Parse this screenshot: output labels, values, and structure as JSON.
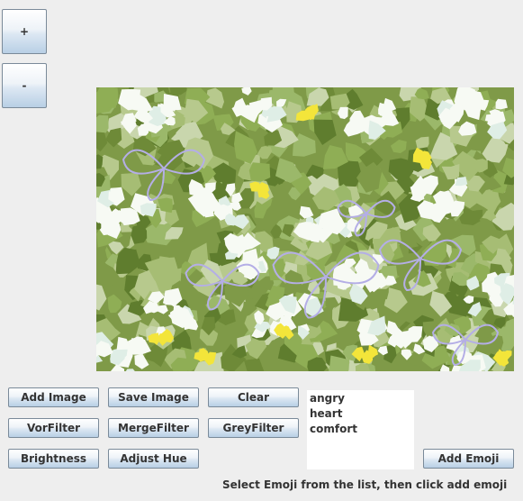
{
  "zoom": {
    "in_label": "+",
    "out_label": "-"
  },
  "buttons": {
    "add_image": "Add Image",
    "save_image": "Save Image",
    "clear": "Clear",
    "vor_filter": "VorFilter",
    "merge_filter": "MergeFilter",
    "grey_filter": "GreyFilter",
    "brightness": "Brightness",
    "adjust_hue": "Adjust Hue",
    "add_emoji": "Add Emoji"
  },
  "emoji_list": {
    "items": [
      "angry",
      "heart",
      "comfort"
    ]
  },
  "status_text": "Select Emoji from the list, then click add emoji",
  "image": {
    "subject": "voronoi-filtered photo of white flowers and lavender butterfly outlines on green foliage",
    "colors": {
      "foliage_dark": "#5f7d2e",
      "foliage": "#7f9a48",
      "foliage_light": "#a6bd74",
      "flower_white": "#f7faf4",
      "flower_yellow": "#f3e53a",
      "butterfly_lavender": "#b4aee6"
    }
  }
}
